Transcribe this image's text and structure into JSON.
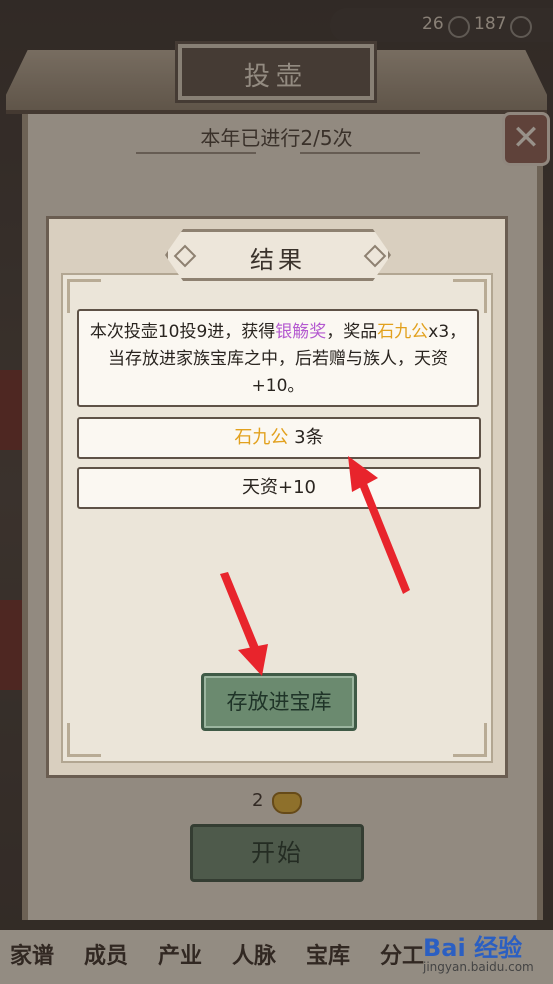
{
  "hud": {
    "value_a": "26",
    "value_b": "187"
  },
  "scroll": {
    "title": "投壶",
    "progress": "本年已进行2/5次",
    "close_icon": "✕"
  },
  "footer": {
    "gold_count": "2",
    "start_label": "开始",
    "nav": [
      "家谱",
      "成员",
      "产业",
      "人脉",
      "宝库",
      "分工"
    ]
  },
  "modal": {
    "title": "结果",
    "message": {
      "part1": "本次投壶10投9进，获得",
      "award": "银觞奖",
      "part2": "，奖品",
      "item": "石九公",
      "part3": "x3，当存放进家族宝库之中，后若赠与族人，天资+10。"
    },
    "reward_item_name": "石九公",
    "reward_item_qty": " 3条",
    "reward_stat": "天资+10",
    "store_label": "存放进宝库"
  },
  "watermark": {
    "logo": "Bai 经验",
    "url": "jingyan.baidu.com"
  },
  "colors": {
    "award": "#b45ad0",
    "item": "#e2a11e",
    "button_green": "#6b8a6f"
  }
}
